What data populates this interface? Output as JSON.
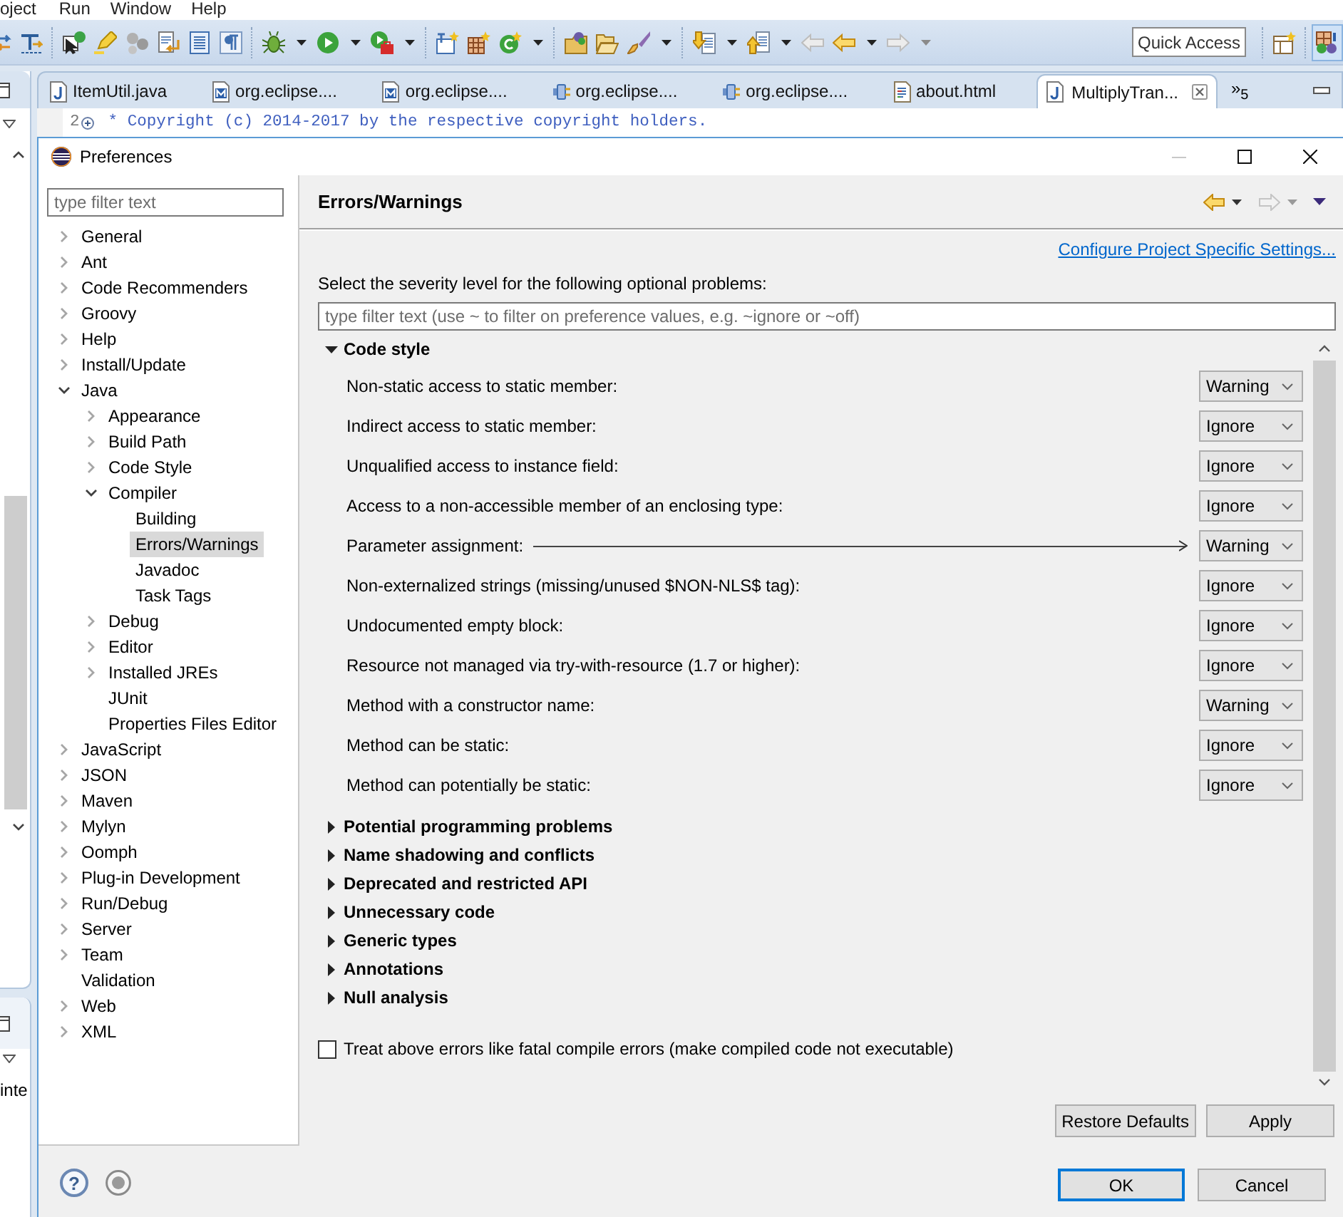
{
  "menu_bar": {
    "items": [
      "oject",
      "Run",
      "Window",
      "Help"
    ]
  },
  "toolbar": {
    "quick_access": {
      "placeholder": "Quick Access"
    }
  },
  "editor_tabs": {
    "items": [
      {
        "label": "ItemUtil.java",
        "kind": "java",
        "selected": false
      },
      {
        "label": "org.eclipse....",
        "kind": "manifest",
        "selected": false
      },
      {
        "label": "org.eclipse....",
        "kind": "manifest",
        "selected": false
      },
      {
        "label": "org.eclipse....",
        "kind": "plugin",
        "selected": false
      },
      {
        "label": "org.eclipse....",
        "kind": "plugin",
        "selected": false
      },
      {
        "label": "about.html",
        "kind": "html",
        "selected": false
      },
      {
        "label": "MultiplyTran...",
        "kind": "java",
        "selected": true
      }
    ],
    "overflow": "»$_{5}$"
  },
  "editor": {
    "line_number": "2",
    "text": "* Copyright (c) 2014-2017 by the respective copyright holders."
  },
  "side_view": {
    "text": "inte"
  },
  "dialog": {
    "title": "Preferences",
    "filter": {
      "placeholder": "type filter text"
    },
    "tree": [
      {
        "label": "General",
        "expanded": false,
        "selected": false
      },
      {
        "label": "Ant",
        "expanded": false,
        "selected": false
      },
      {
        "label": "Code Recommenders",
        "expanded": false,
        "selected": false
      },
      {
        "label": "Groovy",
        "expanded": false,
        "selected": false
      },
      {
        "label": "Help",
        "expanded": false,
        "selected": false
      },
      {
        "label": "Install/Update",
        "expanded": false,
        "selected": false
      },
      {
        "label": "Java",
        "expanded": true,
        "selected": false,
        "children": [
          {
            "label": "Appearance",
            "expanded": false,
            "selected": false
          },
          {
            "label": "Build Path",
            "expanded": false,
            "selected": false
          },
          {
            "label": "Code Style",
            "expanded": false,
            "selected": false
          },
          {
            "label": "Compiler",
            "expanded": true,
            "selected": false,
            "children": [
              {
                "label": "Building",
                "selected": false
              },
              {
                "label": "Errors/Warnings",
                "selected": true
              },
              {
                "label": "Javadoc",
                "selected": false
              },
              {
                "label": "Task Tags",
                "selected": false
              }
            ]
          },
          {
            "label": "Debug",
            "expanded": false,
            "selected": false
          },
          {
            "label": "Editor",
            "expanded": false,
            "selected": false
          },
          {
            "label": "Installed JREs",
            "expanded": false,
            "selected": false
          },
          {
            "label": "JUnit",
            "selected": false
          },
          {
            "label": "Properties Files Editor",
            "selected": false
          }
        ]
      },
      {
        "label": "JavaScript",
        "expanded": false,
        "selected": false
      },
      {
        "label": "JSON",
        "expanded": false,
        "selected": false
      },
      {
        "label": "Maven",
        "expanded": false,
        "selected": false
      },
      {
        "label": "Mylyn",
        "expanded": false,
        "selected": false
      },
      {
        "label": "Oomph",
        "expanded": false,
        "selected": false
      },
      {
        "label": "Plug-in Development",
        "expanded": false,
        "selected": false
      },
      {
        "label": "Run/Debug",
        "expanded": false,
        "selected": false
      },
      {
        "label": "Server",
        "expanded": false,
        "selected": false
      },
      {
        "label": "Team",
        "expanded": false,
        "selected": false
      },
      {
        "label": "Validation",
        "selected": false
      },
      {
        "label": "Web",
        "expanded": false,
        "selected": false
      },
      {
        "label": "XML",
        "expanded": false,
        "selected": false
      }
    ],
    "page": {
      "title": "Errors/Warnings",
      "link": "Configure Project Specific Settings...",
      "intro": "Select the severity level for the following optional problems:",
      "filter": {
        "placeholder": "type filter text (use ~ to filter on preference values, e.g. ~ignore or ~off)"
      },
      "sections": [
        {
          "label": "Code style",
          "expanded": true,
          "options": [
            {
              "label": "Non-static access to static member:",
              "value": "Warning",
              "annotated": false
            },
            {
              "label": "Indirect access to static member:",
              "value": "Ignore",
              "annotated": false
            },
            {
              "label": "Unqualified access to instance field:",
              "value": "Ignore",
              "annotated": false
            },
            {
              "label": "Access to a non-accessible member of an enclosing type:",
              "value": "Ignore",
              "annotated": false
            },
            {
              "label": "Parameter assignment:",
              "value": "Warning",
              "annotated": true
            },
            {
              "label": "Non-externalized strings (missing/unused $NON-NLS$ tag):",
              "value": "Ignore",
              "annotated": false
            },
            {
              "label": "Undocumented empty block:",
              "value": "Ignore",
              "annotated": false
            },
            {
              "label": "Resource not managed via try-with-resource (1.7 or higher):",
              "value": "Ignore",
              "annotated": false
            },
            {
              "label": "Method with a constructor name:",
              "value": "Warning",
              "annotated": false
            },
            {
              "label": "Method can be static:",
              "value": "Ignore",
              "annotated": false
            },
            {
              "label": "Method can potentially be static:",
              "value": "Ignore",
              "annotated": false
            }
          ]
        },
        {
          "label": "Potential programming problems",
          "expanded": false
        },
        {
          "label": "Name shadowing and conflicts",
          "expanded": false
        },
        {
          "label": "Deprecated and restricted API",
          "expanded": false
        },
        {
          "label": "Unnecessary code",
          "expanded": false
        },
        {
          "label": "Generic types",
          "expanded": false
        },
        {
          "label": "Annotations",
          "expanded": false
        },
        {
          "label": "Null analysis",
          "expanded": false
        }
      ],
      "checkbox": {
        "label": "Treat above errors like fatal compile errors (make compiled code not executable)",
        "checked": false
      },
      "buttons": [
        "Restore Defaults",
        "Apply"
      ]
    },
    "help": "?",
    "buttons": [
      {
        "label": "OK",
        "default": true
      },
      {
        "label": "Cancel",
        "default": false
      }
    ]
  }
}
